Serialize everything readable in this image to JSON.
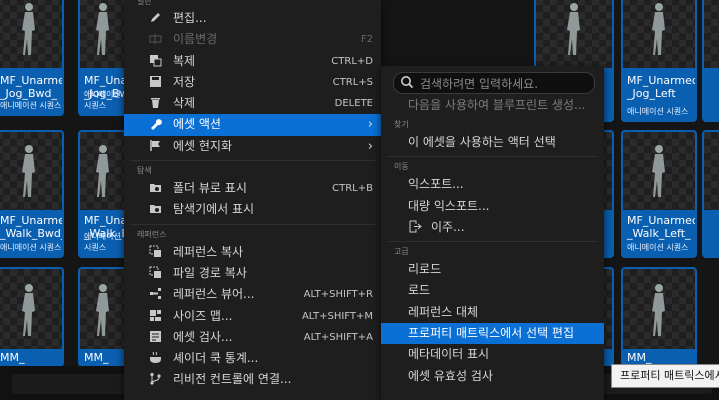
{
  "assets": [
    {
      "name": "MF_Unarmed\n_Jog_Bwd_",
      "kind": "애니메이션 시퀀스"
    },
    {
      "name": "MF_Unarmed\n_Jog_Bwd_",
      "kind": "애니메이션 시퀀스"
    },
    {
      "name": "MF_Unarmed\n_Jog_Left",
      "kind": "애니메이션 시퀀스"
    },
    {
      "name": "MF_Unarmed\n_Walk_Bwd_",
      "kind": "애니메이션 시퀀스"
    },
    {
      "name": "MF_Unarmed\n_Walk_Bwd_",
      "kind": "애니메이션 시퀀스"
    },
    {
      "name": "MF_Unarmed\n_Walk_Left_",
      "kind": "애니메이션 시퀀스"
    },
    {
      "name": "MM_",
      "kind": ""
    },
    {
      "name": "MM_",
      "kind": ""
    },
    {
      "name": "MM_",
      "kind": ""
    }
  ],
  "main_menu": {
    "top_section": "일반",
    "edit": "편집...",
    "rename": "이름변경",
    "rename_sc": "F2",
    "duplicate": "복제",
    "duplicate_sc": "CTRL+D",
    "save": "저장",
    "save_sc": "CTRL+S",
    "delete": "삭제",
    "delete_sc": "DELETE",
    "asset_actions": "에셋 액션",
    "asset_localization": "에셋 현지화",
    "explore_section": "탐색",
    "show_in_folder_view": "폴더 뷰로 표시",
    "show_in_folder_view_sc": "CTRL+B",
    "show_in_explorer": "탐색기에서 표시",
    "references_section": "레퍼런스",
    "copy_reference": "레퍼런스 복사",
    "copy_file_path": "파일 경로 복사",
    "reference_viewer": "레퍼런스 뷰어...",
    "reference_viewer_sc": "ALT+SHIFT+R",
    "size_map": "사이즈 맵...",
    "size_map_sc": "ALT+SHIFT+M",
    "audit_assets": "에셋 검사...",
    "audit_assets_sc": "ALT+SHIFT+A",
    "shader_cook_stats": "셰이더 쿡 통계...",
    "connect_source_control": "리비전 컨트롤에 연결..."
  },
  "sub_menu": {
    "search_placeholder": "검색하려면 입력하세요.",
    "hint": "다음을 사용하여 블루프린트 생성...",
    "find_section": "찾기",
    "select_actors": "이 에셋을 사용하는 액터 선택",
    "move_section": "이동",
    "export": "익스포트...",
    "bulk_export": "대량 익스포트...",
    "migrate": "이주...",
    "advanced_section": "고급",
    "reload": "리로드",
    "load": "로드",
    "replace_references": "레퍼런스 대체",
    "property_matrix": "프로퍼티 매트릭스에서 선택 편집",
    "show_metadata": "메타데이터 표시",
    "validate_assets": "에셋 유효성 검사"
  },
  "tooltip": "프로퍼티 매트릭스에서",
  "colors": {
    "accent": "#0a70d6",
    "tile": "#0a5fb0"
  }
}
